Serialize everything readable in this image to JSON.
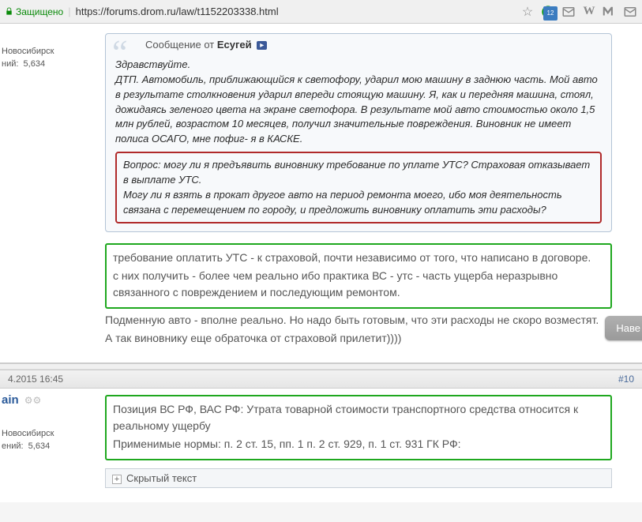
{
  "addr": {
    "secure": "Защищено",
    "url": "https://forums.drom.ru/law/t1152203338.html",
    "badge": "12"
  },
  "post1": {
    "user": {
      "city": "Новосибирск",
      "msgs_label": "ний:",
      "msgs": "5,634"
    },
    "quote": {
      "msg_from": "Сообщение от",
      "author": "Есугей",
      "arrow": "▸",
      "greeting": "Здравствуйте.",
      "para": "ДТП. Автомобиль, приближающийся к светофору, ударил мою машину в заднюю часть. Мой авто в результате столкновения ударил впереди стоящую машину. Я, как и передняя машина, стоял, дожидаясь зеленого цвета на экране светофора. В результате мой авто стоимостью около 1,5 млн рублей, возрастом 10 месяцев, получил значительные повреждения. Виновник не имеет полиса ОСАГО, мне пофиг- я в КАСКЕ.",
      "q1": "Вопрос: могу ли я предъявить виновнику требование по уплате УТС? Страховая отказывает в выплате УТС.",
      "q2": "Могу ли я взять в прокат другое авто на период ремонта моего, ибо моя деятельность связана с перемещением по городу, и предложить виновнику оплатить эти расходы?"
    },
    "reply": {
      "g1": "требование оплатить УТС - к страховой, почти независимо от того, что написано в договоре.",
      "g2": "с них получить - более чем реально ибо практика ВС - утс - часть ущерба неразрывно связанного с повреждением и последующим ремонтом.",
      "p1": "Подменную авто - вполне реально. Но надо быть готовым, что эти расходы не скоро возместят.",
      "p2": "А так виновнику еще обраточка от страховой прилетит))))"
    },
    "nave": "Наве"
  },
  "post2": {
    "date": "4.2015 16:45",
    "num": "#10",
    "user": {
      "name": "ain",
      "cars": "⚙⚙",
      "city": "Новосибирск",
      "msgs_label": "ений:",
      "msgs": "5,634"
    },
    "green": {
      "l1": "Позиция ВС РФ, ВАС РФ: Утрата товарной стоимости транспортного средства относится к реальному ущербу",
      "l2": "Применимые нормы: п. 2 ст. 15, пп. 1 п. 2 ст. 929, п. 1 ст. 931 ГК РФ:"
    },
    "spoiler": "Скрытый текст"
  }
}
